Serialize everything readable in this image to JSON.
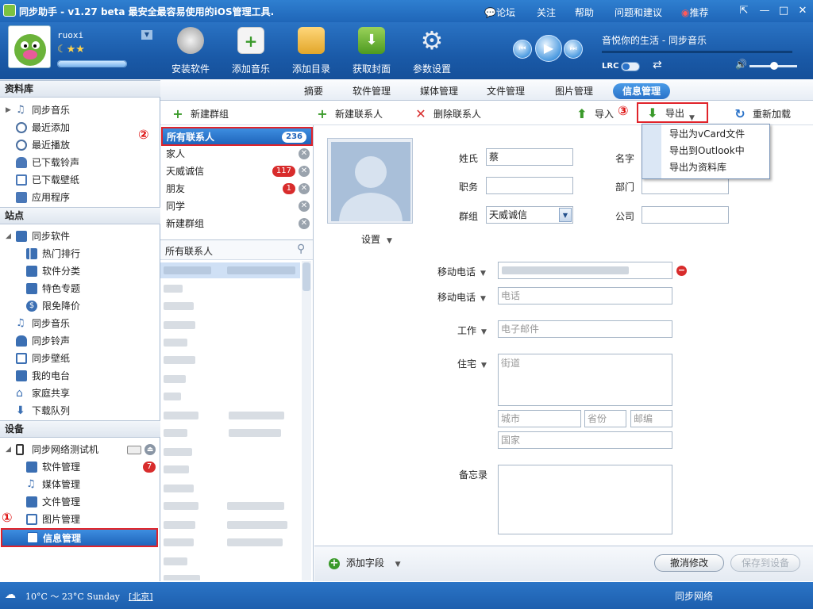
{
  "window": {
    "title": "同步助手 - v1.27 beta  最安全最容易使用的iOS管理工具.",
    "links": [
      "论坛",
      "关注",
      "帮助",
      "问题和建议",
      "推荐"
    ]
  },
  "user": {
    "name": "ruoxi",
    "stars": "☾★★"
  },
  "toolbar_main": [
    "安装软件",
    "添加音乐",
    "添加目录",
    "获取封面",
    "参数设置"
  ],
  "player": {
    "title": "音悦你的生活 - 同步音乐",
    "lrc": "LRC"
  },
  "sidebar": {
    "sections": [
      "资料库",
      "站点",
      "设备"
    ],
    "library": [
      "同步音乐",
      "最近添加",
      "最近播放",
      "已下载铃声",
      "已下载壁纸",
      "应用程序"
    ],
    "sites": [
      "同步软件",
      "热门排行",
      "软件分类",
      "特色专题",
      "限免降价",
      "同步音乐",
      "同步铃声",
      "同步壁纸",
      "我的电台",
      "家庭共享",
      "下载队列"
    ],
    "device_name": "同步网络测试机",
    "device_items": [
      "软件管理",
      "媒体管理",
      "文件管理",
      "图片管理",
      "信息管理"
    ],
    "software_badge": "7"
  },
  "tabs": [
    "摘要",
    "软件管理",
    "媒体管理",
    "文件管理",
    "图片管理",
    "信息管理"
  ],
  "actions": {
    "new_group": "新建群组",
    "new_contact": "新建联系人",
    "delete_contact": "删除联系人",
    "import": "导入",
    "export": "导出",
    "reload": "重新加载"
  },
  "groups": [
    {
      "name": "所有联系人",
      "count": "236"
    },
    {
      "name": "家人",
      "count": ""
    },
    {
      "name": "天威诚信",
      "count": "117"
    },
    {
      "name": "朋友",
      "count": "1"
    },
    {
      "name": "同学",
      "count": ""
    },
    {
      "name": "新建群组",
      "count": ""
    }
  ],
  "contacts_header": "所有联系人",
  "export_menu": [
    "导出为vCard文件",
    "导出到Outlook中",
    "导出为资料库"
  ],
  "annotations": [
    "①",
    "②",
    "③"
  ],
  "form": {
    "photo_setting": "设置",
    "surname_label": "姓氏",
    "surname_value": "蔡",
    "name_label": "名字",
    "title_label": "职务",
    "dept_label": "部门",
    "group_label": "群组",
    "group_value": "天威诚信",
    "company_label": "公司",
    "mobile_label": "移动电话",
    "mobile_label2": "移动电话",
    "phone_placeholder": "电话",
    "work_label": "工作",
    "email_placeholder": "电子邮件",
    "home_label": "住宅",
    "street_placeholder": "街道",
    "city_placeholder": "城市",
    "province_placeholder": "省份",
    "zip_placeholder": "邮编",
    "country_placeholder": "国家",
    "notes_label": "备忘录",
    "add_field": "添加字段",
    "cancel": "撤消修改",
    "save": "保存到设备"
  },
  "status": {
    "weather": "10°C ～ 23°C  Sunday",
    "city": "[北京]",
    "right": "同步网络"
  },
  "colors": {
    "accent": "#2a72c8",
    "annotation": "#e0232a"
  }
}
